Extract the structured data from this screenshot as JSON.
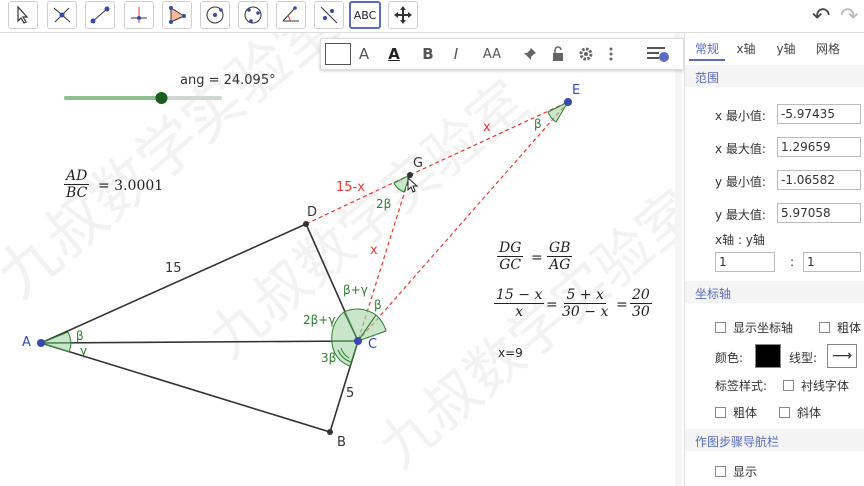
{
  "toolbar": {
    "tools": [
      "move-tool",
      "point-tool",
      "segment-tool",
      "perpendicular-tool",
      "polygon-tool",
      "circle-tool",
      "circle-three-points-tool",
      "angle-tool",
      "reflect-tool",
      "text-tool",
      "move-view-tool"
    ],
    "text_tool_label": "ABC"
  },
  "styletb": {
    "text_label_a": "A",
    "text_label_a2": "A",
    "bold": "B",
    "italic": "I",
    "size": "AA"
  },
  "graphics": {
    "slider_label": "ang = 24.095°",
    "slider_value": 0.62,
    "ratio_label_eq": "= 3.0001",
    "ratio_num": "AD",
    "ratio_den": "BC",
    "points": {
      "A": "A",
      "B": "B",
      "C": "C",
      "D": "D",
      "E": "E",
      "G": "G"
    },
    "seg_labels": {
      "ad": "15",
      "bc": "5",
      "dg": "15-x",
      "ge": "x",
      "gc": "x"
    },
    "angle_labels": {
      "a1": "β",
      "a2": "γ",
      "c1": "β+γ",
      "c2": "2β+γ",
      "c3": "3β",
      "c4": "β",
      "e1": "β",
      "g1": "2β"
    },
    "eq1": {
      "l_num": "DG",
      "l_den": "GC",
      "r_num": "GB",
      "r_den": "AG",
      "eq": "="
    },
    "eq2": {
      "a_num": "15 − x",
      "a_den": "x",
      "b_num": "5 + x",
      "b_den": "30 − x",
      "c_num": "20",
      "c_den": "30",
      "eq": "="
    },
    "result": "x=9",
    "watermark": "九叔数学实验室"
  },
  "panel": {
    "tabs": [
      "常规",
      "x轴",
      "y轴",
      "网格"
    ],
    "range_title": "范围",
    "xmin_label": "x 最小值:",
    "xmin": "-5.97435",
    "xmax_label": "x 最大值:",
    "xmax": "1.29659",
    "ymin_label": "y 最小值:",
    "ymin": "-1.06582",
    "ymax_label": "y 最大值:",
    "ymax": "5.97058",
    "ratio_label": "x轴 : y轴",
    "ratio_x": "1",
    "ratio_sep": ":",
    "ratio_y": "1",
    "axes_title": "坐标轴",
    "show_axes": "显示坐标轴",
    "bold": "粗体",
    "color_label": "颜色:",
    "linetype_label": "线型:",
    "label_style": "标签样式:",
    "serif": "衬线字体",
    "bold2": "粗体",
    "italic": "斜体",
    "nav_title": "作图步骤导航栏",
    "show": "显示"
  },
  "colors": {
    "accent": "#5c6bc0",
    "dashed": "#e53935",
    "angle": "#2e7d32",
    "point": "#3949ab"
  }
}
